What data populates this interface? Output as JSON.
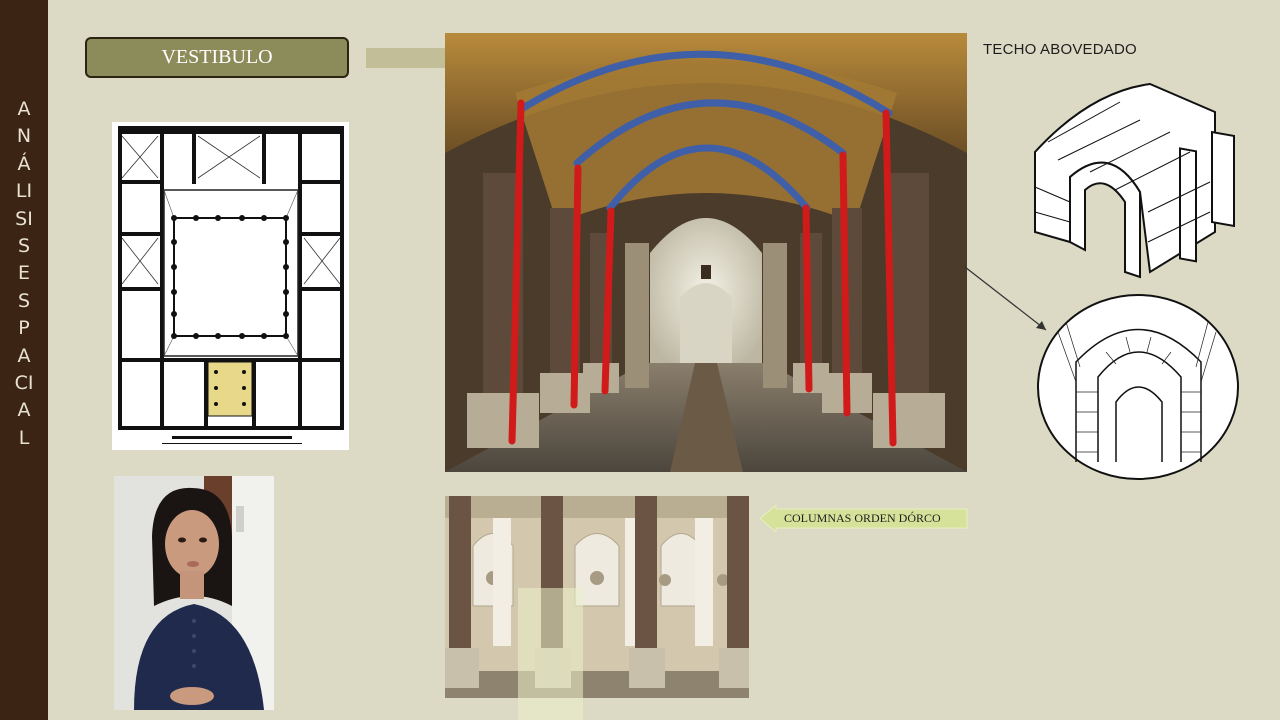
{
  "sidebar": {
    "title": "ANÁLISIS ESPACIAL"
  },
  "section": {
    "label": "VESTIBULO"
  },
  "annotations": {
    "vault_label": "TECHO ABOVEDADO",
    "columns_label": "COLUMNAS ORDEN DÓRCO"
  },
  "colors": {
    "sidebar": "#3b2413",
    "background": "#dcdac5",
    "pill": "#8c8b5a",
    "arch_blue": "#3f5fa8",
    "column_red": "#d11a1a",
    "callout_green": "#d6e29a"
  }
}
